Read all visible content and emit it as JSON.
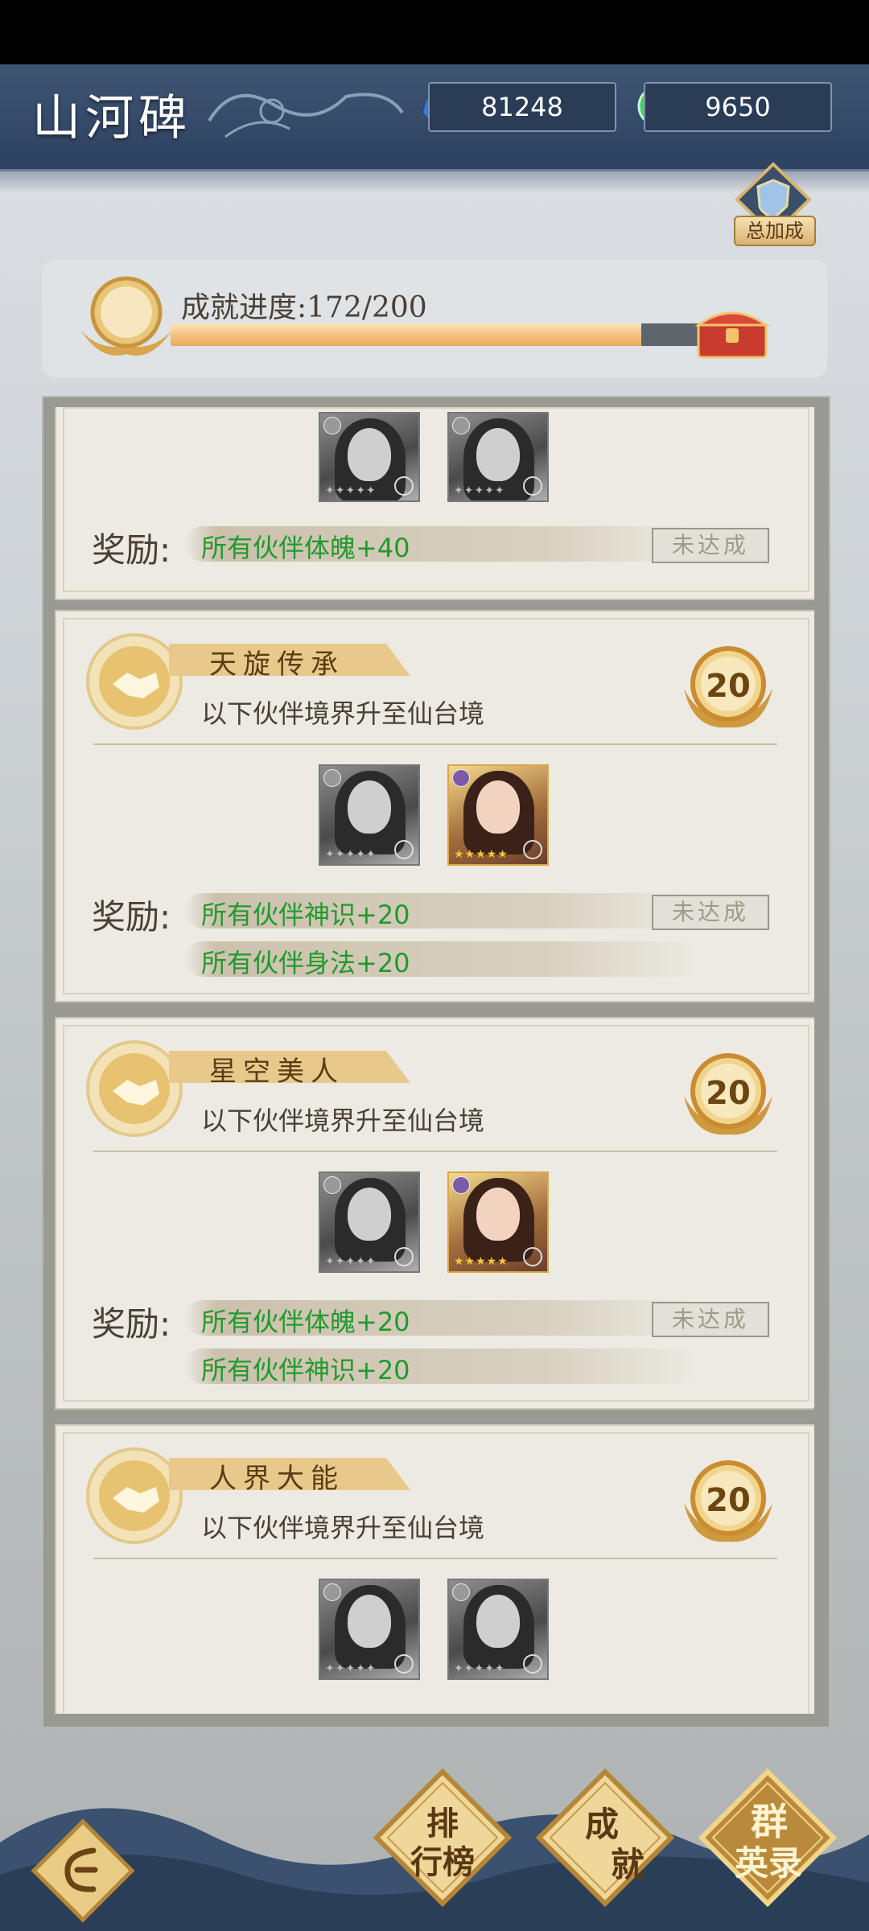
{
  "header": {
    "title": "山河碑",
    "crystals": "81248",
    "jade": "9650",
    "total_bonus_label": "总加成"
  },
  "progress": {
    "label": "成就进度:",
    "value": "172/200",
    "current": 172,
    "total": 200
  },
  "partial_card": {
    "rewards": [
      "所有伙伴体魄+40"
    ],
    "status": "未达成"
  },
  "cards": [
    {
      "title": "天旋传承",
      "desc": "以下伙伴境界升至仙台境",
      "points": "20",
      "rewards": [
        "所有伙伴神识+20",
        "所有伙伴身法+20"
      ],
      "status": "未达成"
    },
    {
      "title": "星空美人",
      "desc": "以下伙伴境界升至仙台境",
      "points": "20",
      "rewards": [
        "所有伙伴体魄+20",
        "所有伙伴神识+20"
      ],
      "status": "未达成"
    },
    {
      "title": "人界大能",
      "desc": "以下伙伴境界升至仙台境",
      "points": "20",
      "rewards": [],
      "status": ""
    }
  ],
  "reward_label": "奖励:",
  "bottom_nav": {
    "leaderboard_line1": "排",
    "leaderboard_line2": "行榜",
    "achievement_line1": "成",
    "achievement_line2": "就",
    "heroes_line1": "群",
    "heroes_line2": "英录"
  },
  "colors": {
    "header_bg": "#2d4260",
    "reward_green": "#1f9b2c",
    "progress_fill": "#f2bd78",
    "card_bg": "#eceae2"
  }
}
